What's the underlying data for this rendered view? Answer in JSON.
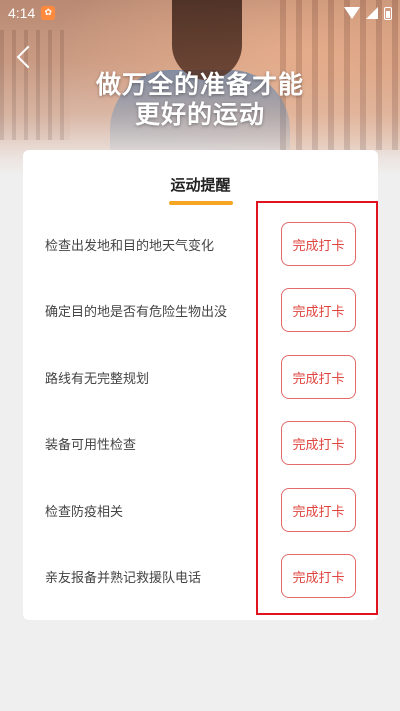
{
  "status_bar": {
    "time": "4:14",
    "app_icon": "app-notification-icon"
  },
  "hero": {
    "title_line1": "做万全的准备才能",
    "title_line2": "更好的运动"
  },
  "card": {
    "title": "运动提醒",
    "tasks": [
      {
        "label": "检查出发地和目的地天气变化",
        "button": "完成打卡"
      },
      {
        "label": "确定目的地是否有危险生物出没",
        "button": "完成打卡"
      },
      {
        "label": "路线有无完整规划",
        "button": "完成打卡"
      },
      {
        "label": "装备可用性检查",
        "button": "完成打卡"
      },
      {
        "label": "检查防疫相关",
        "button": "完成打卡"
      },
      {
        "label": "亲友报备并熟记救援队电话",
        "button": "完成打卡"
      }
    ]
  },
  "colors": {
    "accent_underline": "#f6a623",
    "button_text": "#e0443f",
    "highlight_box": "#e0141e"
  }
}
